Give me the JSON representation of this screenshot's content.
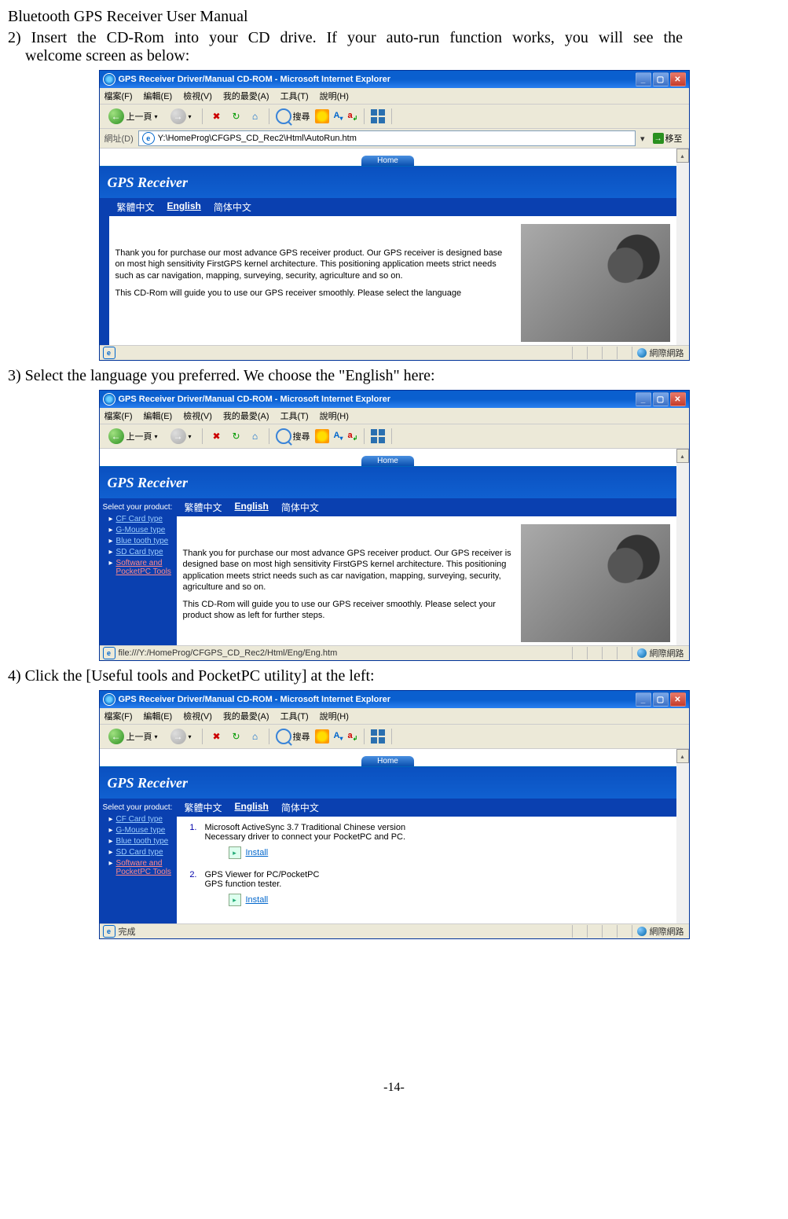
{
  "doc": {
    "title": "Bluetooth GPS Receiver User Manual",
    "step2_line1": "2) Insert the CD-Rom into your CD drive. If your auto-run function works, you will see the",
    "step2_line2": "welcome screen as below:",
    "step3": "3) Select the language you preferred. We choose the \"English\" here:",
    "step4": "4) Click the [Useful tools and PocketPC utility] at the left:",
    "page_num": "-14-"
  },
  "ie": {
    "title": "GPS Receiver Driver/Manual CD-ROM - Microsoft Internet Explorer",
    "menu": {
      "file": "檔案(F)",
      "edit": "編輯(E)",
      "view": "檢視(V)",
      "fav": "我的最愛(A)",
      "tools": "工具(T)",
      "help": "說明(H)"
    },
    "toolbar": {
      "back": "上一頁",
      "search": "搜尋"
    },
    "addr_label": "網址(D)",
    "go_label": "移至",
    "status_done": "完成",
    "zone": "網際網路"
  },
  "shot1": {
    "address": "Y:\\HomeProg\\CFGPS_CD_Rec2\\Html\\AutoRun.htm",
    "home": "Home",
    "banner": "GPS Receiver",
    "lang": {
      "tc": "繁體中文",
      "en": "English",
      "sc": "简体中文"
    },
    "body_p1": "Thank you for purchase our most advance GPS receiver product. Our GPS receiver is designed base on most high sensitivity FirstGPS kernel architecture. This positioning application meets strict needs such as car navigation, mapping, surveying, security, agriculture and so on.",
    "body_p2": "This CD-Rom will guide you to use our GPS receiver smoothly. Please select the language"
  },
  "shot2": {
    "address": "file:///Y:/HomeProg/CFGPS_CD_Rec2/Html/Eng/Eng.htm",
    "home": "Home",
    "banner": "GPS Receiver",
    "lang": {
      "tc": "繁體中文",
      "en": "English",
      "sc": "简体中文"
    },
    "sidebar_label": "Select your product:",
    "sidebar_items": [
      "CF Card type",
      "G-Mouse type",
      "Blue tooth type",
      "SD Card type",
      "Software and PocketPC Tools"
    ],
    "body_p1": "Thank you for purchase our most advance GPS receiver product. Our GPS receiver is designed base on most high sensitivity FirstGPS kernel architecture. This positioning application meets strict needs such as car navigation, mapping, surveying, security, agriculture and so on.",
    "body_p2": "This CD-Rom will guide you to use our GPS receiver smoothly. Please select your product show as left for further steps."
  },
  "shot3": {
    "home": "Home",
    "banner": "GPS Receiver",
    "lang": {
      "tc": "繁體中文",
      "en": "English",
      "sc": "简体中文"
    },
    "sidebar_label": "Select your product:",
    "sidebar_items": [
      "CF Card type",
      "G-Mouse type",
      "Blue tooth type",
      "SD Card type",
      "Software and PocketPC Tools"
    ],
    "item1_num": "1.",
    "item1_l1": "Microsoft ActiveSync 3.7 Traditional Chinese version",
    "item1_l2": "Necessary driver to connect your PocketPC and PC.",
    "item2_num": "2.",
    "item2_l1": "GPS Viewer for PC/PocketPC",
    "item2_l2": "GPS function tester.",
    "install": "Install"
  }
}
